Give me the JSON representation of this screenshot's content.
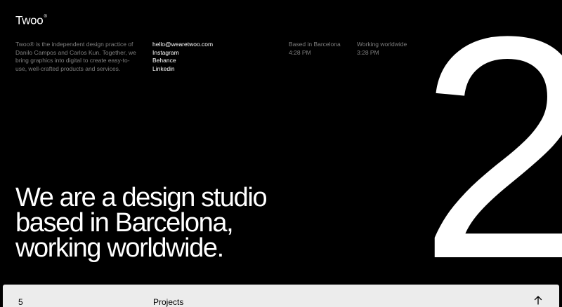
{
  "header": {
    "logo_text": "Twoo",
    "logo_mark": "®"
  },
  "intro": {
    "text": "Twoo® is the independent design practice of Danilo Campos and Carlos Kun. Together, we bring graphics into digital to create easy-to-use, well-crafted products and services."
  },
  "contact": {
    "email": "hello@wearetwoo.com",
    "links": [
      "Instagram",
      "Behance",
      "Linkedin"
    ]
  },
  "clocks": [
    {
      "label": "Based in Barcelona",
      "time": "4:28 PM"
    },
    {
      "label": "Working worldwide",
      "time": "3:28 PM"
    }
  ],
  "hero": {
    "digit": "2",
    "lines": [
      "We are a design studio",
      "based in Barcelona,",
      "working worldwide."
    ]
  },
  "projects_bar": {
    "count": "5",
    "label": "Projects",
    "icon": "arrow-up-icon"
  },
  "colors": {
    "background": "#000000",
    "text": "#ffffff",
    "muted": "#7f7f7f",
    "bar": "#ececec"
  }
}
